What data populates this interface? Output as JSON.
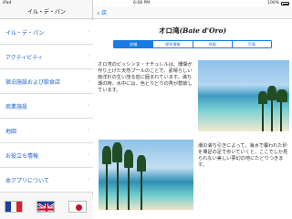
{
  "status_bar": {
    "carrier": "iPad",
    "time": "6:08 PM",
    "battery": "100%"
  },
  "sidebar": {
    "title": "イル・デ・パン",
    "items": [
      {
        "label": "イル・デ・パン"
      },
      {
        "label": "アクティビティ"
      },
      {
        "label": "宿泊施設および飲食店"
      },
      {
        "label": "商業施設"
      },
      {
        "label": "地図"
      },
      {
        "label": "お役立ち情報"
      },
      {
        "label": "本アプリについて"
      }
    ],
    "chevron": "›",
    "flags": [
      "france-flag",
      "uk-flag",
      "japan-flag"
    ]
  },
  "navbar": {
    "back_label": "戻"
  },
  "page": {
    "title_ja": "オロ湾",
    "title_latin": "(Baie d'Oro)",
    "segments": [
      {
        "label": "詳細",
        "active": true
      },
      {
        "label": "便利情報",
        "active": false
      },
      {
        "label": "地図",
        "active": false
      },
      {
        "label": "写真",
        "active": false
      }
    ],
    "paragraph_1": "オロ湾のピッシンヌ・ナチュレルは、珊瑚が作り上げた天然プールのことで、素晴らしい南洋杉の生い茂る岩に囲まれています。満ち潮の時、水中には、色とりどりの魚が群飲しています。",
    "paragraph_2": "潮の満ち引きによって、海水で覆われた砂を裸足の足で歩いていくと、ここでしか見られない美しい夢幻の地にたどりつきます。"
  },
  "colors": {
    "accent": "#1a7be0",
    "link": "#1c5fcf"
  }
}
